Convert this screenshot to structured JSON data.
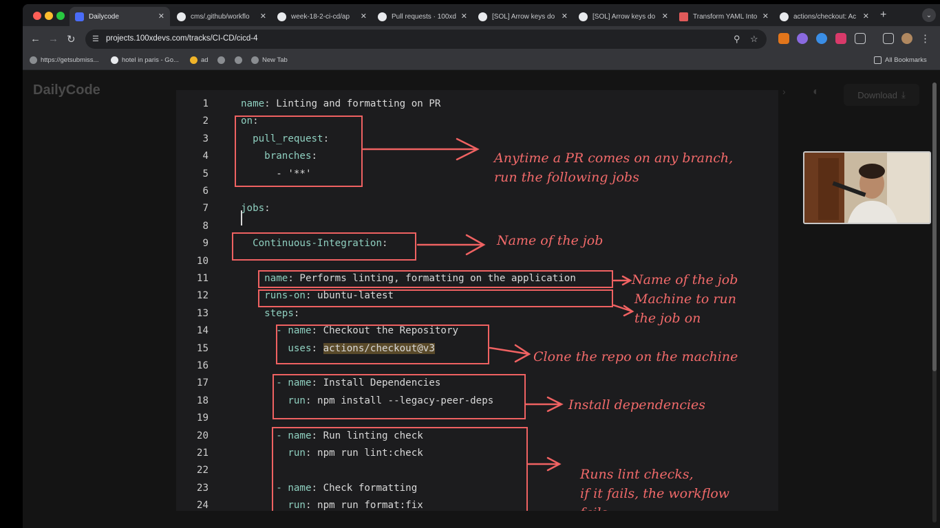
{
  "browser": {
    "tabs": [
      {
        "title": "Dailycode",
        "active": true
      },
      {
        "title": "cms/.github/workflo"
      },
      {
        "title": "week-18-2-ci-cd/ap"
      },
      {
        "title": "Pull requests · 100xd"
      },
      {
        "title": "[SOL] Arrow keys do"
      },
      {
        "title": "[SOL] Arrow keys do"
      },
      {
        "title": "Transform YAML Into"
      },
      {
        "title": "actions/checkout: Ac"
      }
    ],
    "url": "projects.100xdevs.com/tracks/CI-CD/cicd-4",
    "bookmarks": [
      {
        "label": "https://getsubmiss..."
      },
      {
        "label": "hotel in paris - Go..."
      },
      {
        "label": "ad"
      },
      {
        "label": ""
      },
      {
        "label": ""
      },
      {
        "label": "New Tab"
      }
    ],
    "all_bookmarks": "All Bookmarks"
  },
  "page": {
    "logo": "DailyCode",
    "download": "Download"
  },
  "slide": {
    "code_lines": [
      {
        "n": "1",
        "key": "name",
        "rest": ": Linting and formatting on PR"
      },
      {
        "n": "2",
        "key": "on",
        "rest": ":"
      },
      {
        "n": "3",
        "key": "  pull_request",
        "rest": ":"
      },
      {
        "n": "4",
        "key": "    branches",
        "rest": ":"
      },
      {
        "n": "5",
        "key": "",
        "rest": "      - '**'"
      },
      {
        "n": "6",
        "key": "",
        "rest": ""
      },
      {
        "n": "7",
        "key": "jobs",
        "rest": ":"
      },
      {
        "n": "8",
        "key": "",
        "rest": ""
      },
      {
        "n": "9",
        "key": "  Continuous-Integration",
        "rest": ":"
      },
      {
        "n": "10",
        "key": "",
        "rest": ""
      },
      {
        "n": "11",
        "key": "    name",
        "rest": ": Performs linting, formatting on the application"
      },
      {
        "n": "12",
        "key": "    runs-on",
        "rest": ": ubuntu-latest"
      },
      {
        "n": "13",
        "key": "    steps",
        "rest": ":"
      },
      {
        "n": "14",
        "key": "      - name",
        "rest": ": Checkout the Repository"
      },
      {
        "n": "15",
        "key": "        uses",
        "rest": ": actions/checkout@v3"
      },
      {
        "n": "16",
        "key": "",
        "rest": ""
      },
      {
        "n": "17",
        "key": "      - name",
        "rest": ": Install Dependencies"
      },
      {
        "n": "18",
        "key": "        run",
        "rest": ": npm install --legacy-peer-deps"
      },
      {
        "n": "19",
        "key": "",
        "rest": ""
      },
      {
        "n": "20",
        "key": "      - name",
        "rest": ": Run linting check"
      },
      {
        "n": "21",
        "key": "        run",
        "rest": ": npm run lint:check"
      },
      {
        "n": "22",
        "key": "",
        "rest": ""
      },
      {
        "n": "23",
        "key": "      - name",
        "rest": ": Check formatting"
      },
      {
        "n": "24",
        "key": "        run",
        "rest": ": npm run format:fix"
      }
    ],
    "annotations": {
      "pr_line1": "Anytime a PR comes on any branch,",
      "pr_line2": "run the following jobs",
      "job_name": "Name of the job",
      "job_name2": "Name of the job",
      "machine1": "Machine to run",
      "machine2": "the job on",
      "clone": "Clone the repo on the machine",
      "install": "Install dependencies",
      "lint1": "Runs lint checks,",
      "lint2": "if it fails, the workflow",
      "lint3": "fails"
    },
    "colors": {
      "annotation": "#f06262",
      "keyword": "#8fd0c0",
      "code": "#d9d9d9"
    }
  }
}
